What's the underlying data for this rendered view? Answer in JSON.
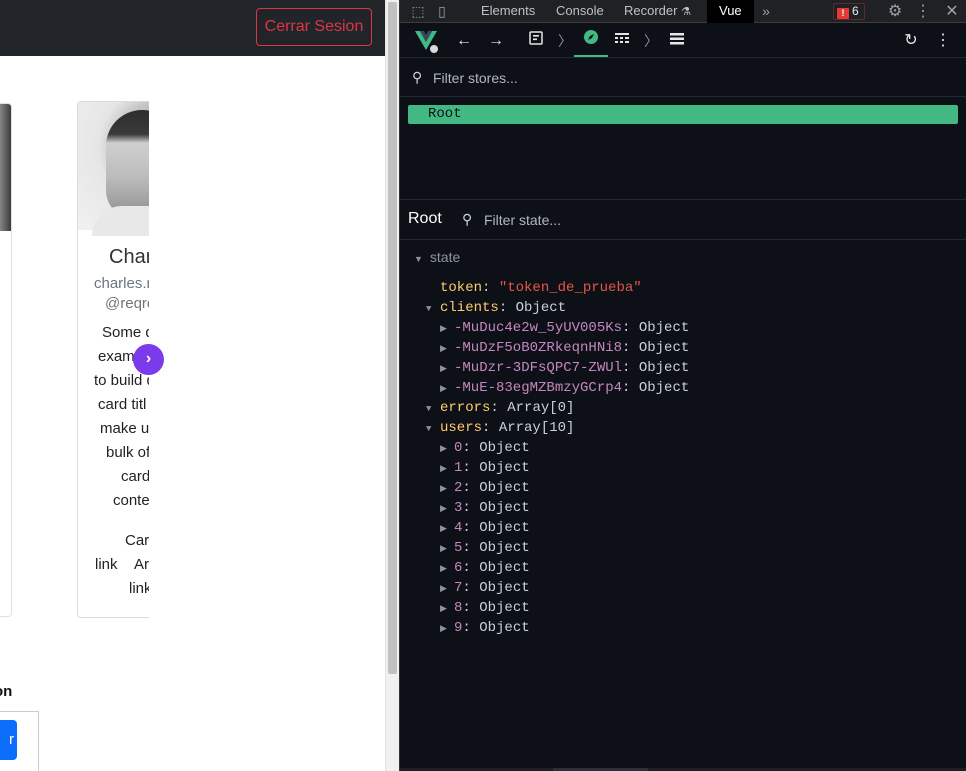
{
  "app": {
    "logout_label": "Cerrar Sesion",
    "card": {
      "title": "Char",
      "email": "charles.r",
      "handle": "@reqre",
      "body_lines": [
        "Some q",
        "exam",
        "to build q",
        "card titl",
        "make u",
        "bulk of",
        "card",
        "conte"
      ],
      "links": [
        "Car",
        "link",
        "Ar",
        "link"
      ]
    },
    "next_icon": "chevron-right-icon",
    "next_label": "›",
    "section_heading": "on",
    "primary_button_label": "r"
  },
  "devtools": {
    "tabs": [
      "Elements",
      "Console",
      "Recorder",
      "Vue"
    ],
    "active_tab": "Vue",
    "more_tabs_label": "»",
    "error_count": "6",
    "vue_toolbar": {
      "logo": "vue-logo",
      "back_label": "←",
      "forward_label": "→",
      "sep": "〉",
      "refresh_label": "↻",
      "menu_label": "⋮"
    },
    "filter_stores_placeholder": "Filter stores...",
    "store_root_label": "Root",
    "state_title": "Root",
    "filter_state_placeholder": "Filter state...",
    "state_label": "state",
    "token_key": "token",
    "token_value": "\"token_de_prueba\"",
    "clients_key": "clients",
    "clients_type": "Object",
    "client_keys": [
      "-MuDuc4e2w_5yUV005Ks",
      "-MuDzF5oB0ZRkeqnHNi8",
      "-MuDzr-3DFsQPC7-ZWUl",
      "-MuE-83egMZBmzyGCrp4"
    ],
    "errors_key": "errors",
    "errors_type": "Array[0]",
    "users_key": "users",
    "users_type": "Array[10]",
    "user_indices": [
      "0",
      "1",
      "2",
      "3",
      "4",
      "5",
      "6",
      "7",
      "8",
      "9"
    ],
    "object_label": "Object",
    "colors": {
      "vue_green": "#42b883",
      "bg": "#0d1117",
      "danger": "#dc3545",
      "next_btn": "#7c3aed"
    }
  }
}
